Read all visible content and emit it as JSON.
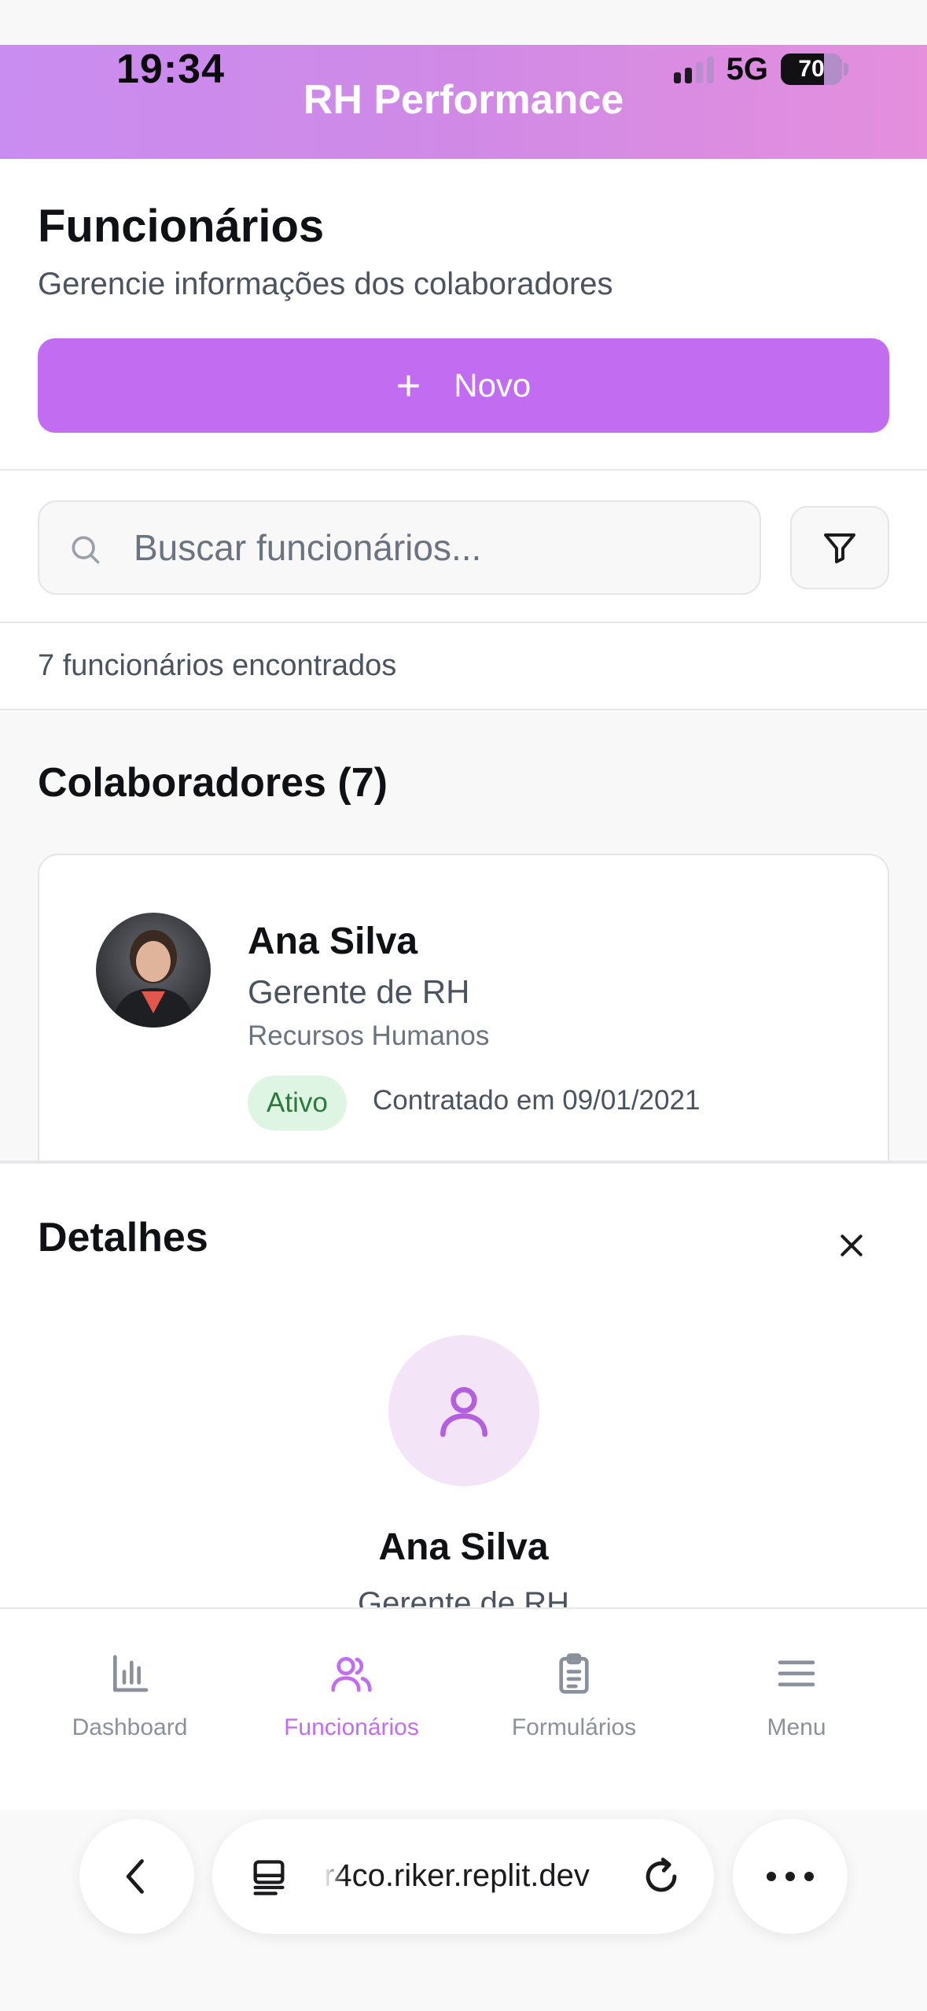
{
  "status_bar": {
    "time": "19:34",
    "network": "5G",
    "battery_level": "70",
    "battery_fraction": 0.7,
    "signal_bars_active": 2,
    "signal_bars_total": 4
  },
  "app": {
    "title": "RH Performance",
    "header_gradient": [
      "#c98cf0",
      "#e58fdd"
    ],
    "accent_color": "#c26cf2"
  },
  "page": {
    "title": "Funcionários",
    "subtitle": "Gerencie informações dos colaboradores",
    "new_button": {
      "icon": "plus-icon",
      "label": "Novo"
    }
  },
  "search": {
    "placeholder": "Buscar funcionários...",
    "value": "",
    "filter_icon": "filter-icon"
  },
  "results": {
    "count_text": "7 funcionários encontrados"
  },
  "list": {
    "title": "Colaboradores (7)",
    "employees": [
      {
        "name": "Ana Silva",
        "role": "Gerente de RH",
        "department": "Recursos Humanos",
        "status": "Ativo",
        "status_color": "#2a7a3d",
        "hired": "Contratado em 09/01/2021"
      }
    ]
  },
  "details": {
    "title": "Detalhes",
    "name": "Ana Silva",
    "role": "Gerente de RH",
    "avatar_icon": "user-icon",
    "close_icon": "close-icon"
  },
  "bottom_nav": {
    "items": [
      {
        "label": "Dashboard",
        "icon": "bar-chart-icon",
        "active": false
      },
      {
        "label": "Funcionários",
        "icon": "users-icon",
        "active": true
      },
      {
        "label": "Formulários",
        "icon": "clipboard-list-icon",
        "active": false
      },
      {
        "label": "Menu",
        "icon": "menu-icon",
        "active": false
      }
    ]
  },
  "browser": {
    "url": "r4co.riker.replit.dev",
    "back_icon": "chevron-left-icon",
    "tabs_icon": "tabs-icon",
    "reload_icon": "reload-icon",
    "more_icon": "more-icon"
  }
}
